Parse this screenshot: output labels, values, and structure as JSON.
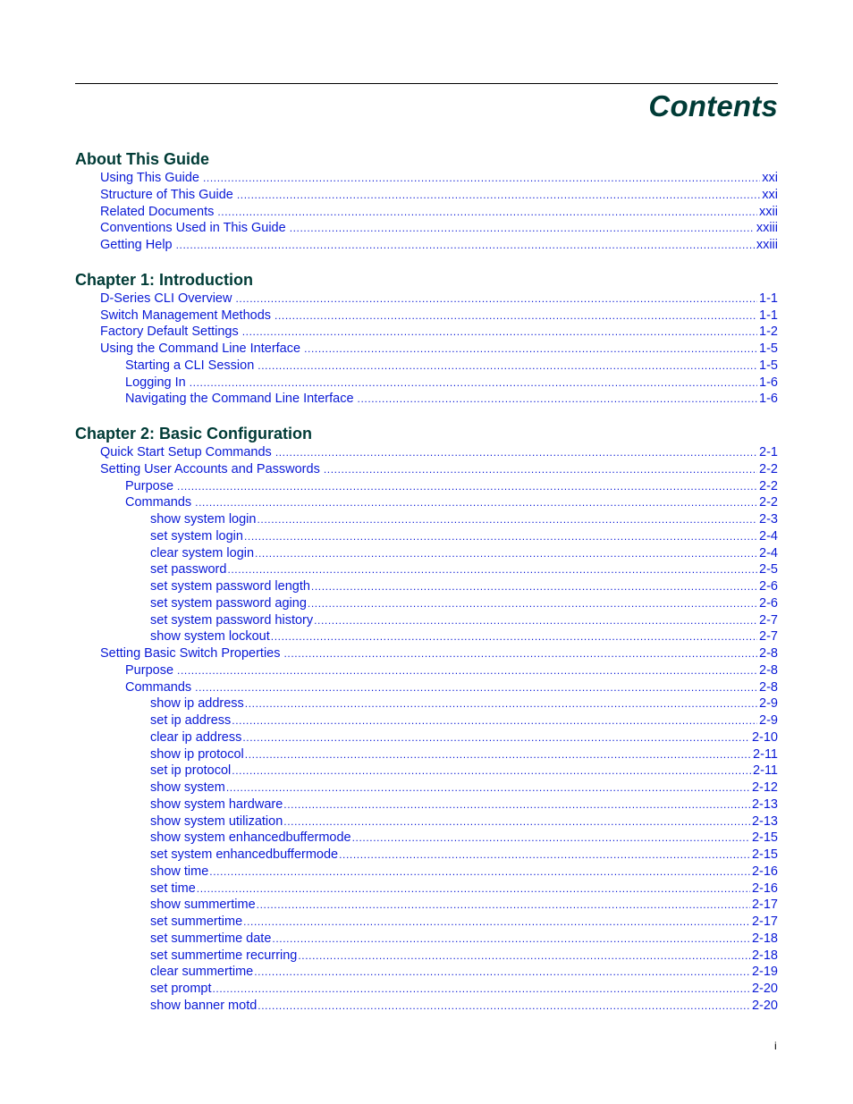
{
  "page": {
    "title": "Contents",
    "folio": "i"
  },
  "sections": [
    {
      "heading": "About This Guide",
      "entries": [
        {
          "label": "Using This Guide",
          "page": "xxi",
          "level": 1
        },
        {
          "label": "Structure of This Guide",
          "page": "xxi",
          "level": 1
        },
        {
          "label": "Related Documents",
          "page": "xxii",
          "level": 1
        },
        {
          "label": "Conventions Used in This Guide",
          "page": "xxiii",
          "level": 1
        },
        {
          "label": "Getting Help",
          "page": "xxiii",
          "level": 1
        }
      ]
    },
    {
      "heading": "Chapter 1: Introduction",
      "entries": [
        {
          "label": "D-Series CLI Overview",
          "page": "1-1",
          "level": 1
        },
        {
          "label": "Switch Management Methods",
          "page": "1-1",
          "level": 1
        },
        {
          "label": "Factory Default Settings",
          "page": "1-2",
          "level": 1
        },
        {
          "label": "Using the Command Line Interface",
          "page": "1-5",
          "level": 1
        },
        {
          "label": "Starting a CLI Session",
          "page": "1-5",
          "level": 2
        },
        {
          "label": "Logging In",
          "page": "1-6",
          "level": 2
        },
        {
          "label": "Navigating the Command Line Interface",
          "page": "1-6",
          "level": 2
        }
      ]
    },
    {
      "heading": "Chapter 2: Basic Configuration",
      "entries": [
        {
          "label": "Quick Start Setup Commands",
          "page": "2-1",
          "level": 1
        },
        {
          "label": "Setting User Accounts and Passwords",
          "page": "2-2",
          "level": 1
        },
        {
          "label": "Purpose",
          "page": "2-2",
          "level": 2
        },
        {
          "label": "Commands",
          "page": "2-2",
          "level": 2
        },
        {
          "label": "show system login",
          "page": "2-3",
          "level": 3
        },
        {
          "label": "set system login",
          "page": "2-4",
          "level": 3
        },
        {
          "label": "clear system login",
          "page": "2-4",
          "level": 3
        },
        {
          "label": "set password",
          "page": "2-5",
          "level": 3
        },
        {
          "label": "set system password length",
          "page": "2-6",
          "level": 3
        },
        {
          "label": "set system password aging",
          "page": "2-6",
          "level": 3
        },
        {
          "label": "set system password history",
          "page": "2-7",
          "level": 3
        },
        {
          "label": "show system lockout",
          "page": "2-7",
          "level": 3
        },
        {
          "label": "Setting Basic Switch Properties",
          "page": "2-8",
          "level": 1
        },
        {
          "label": "Purpose",
          "page": "2-8",
          "level": 2
        },
        {
          "label": "Commands",
          "page": "2-8",
          "level": 2
        },
        {
          "label": "show ip address",
          "page": "2-9",
          "level": 3
        },
        {
          "label": "set ip address",
          "page": "2-9",
          "level": 3
        },
        {
          "label": "clear ip address",
          "page": "2-10",
          "level": 3
        },
        {
          "label": "show ip protocol",
          "page": "2-11",
          "level": 3
        },
        {
          "label": "set ip protocol",
          "page": "2-11",
          "level": 3
        },
        {
          "label": "show system",
          "page": "2-12",
          "level": 3
        },
        {
          "label": "show system hardware",
          "page": "2-13",
          "level": 3
        },
        {
          "label": "show system utilization",
          "page": "2-13",
          "level": 3
        },
        {
          "label": "show system enhancedbuffermode",
          "page": "2-15",
          "level": 3
        },
        {
          "label": "set system enhancedbuffermode",
          "page": "2-15",
          "level": 3
        },
        {
          "label": "show time",
          "page": "2-16",
          "level": 3
        },
        {
          "label": "set time",
          "page": "2-16",
          "level": 3
        },
        {
          "label": "show summertime",
          "page": "2-17",
          "level": 3
        },
        {
          "label": "set summertime",
          "page": "2-17",
          "level": 3
        },
        {
          "label": "set summertime date",
          "page": "2-18",
          "level": 3
        },
        {
          "label": "set summertime recurring",
          "page": "2-18",
          "level": 3
        },
        {
          "label": "clear summertime",
          "page": "2-19",
          "level": 3
        },
        {
          "label": "set prompt",
          "page": "2-20",
          "level": 3
        },
        {
          "label": "show banner motd",
          "page": "2-20",
          "level": 3
        }
      ]
    }
  ],
  "colors": {
    "heading": "#003b36",
    "link": "#0a1ad6"
  }
}
